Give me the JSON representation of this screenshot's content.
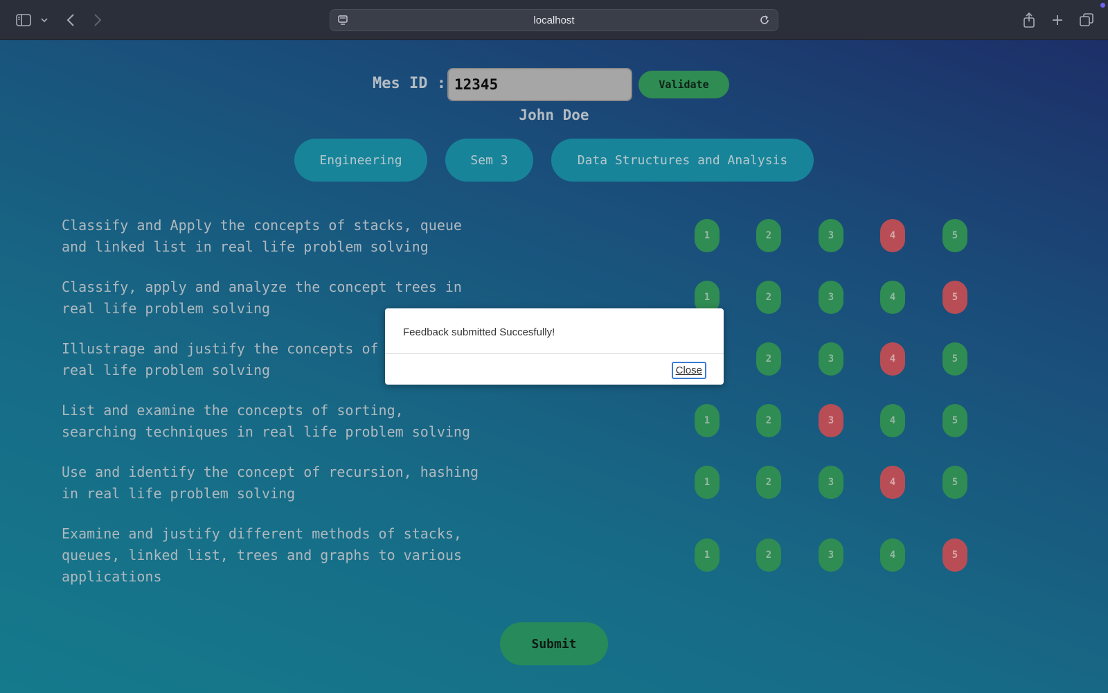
{
  "browser": {
    "url": "localhost",
    "icons": [
      "sidebar-icon",
      "chevron-down-icon",
      "back-icon",
      "forward-icon",
      "site-settings-icon",
      "reload-icon",
      "share-icon",
      "new-tab-icon",
      "tabs-overview-icon"
    ]
  },
  "form": {
    "id_label": "Mes ID :",
    "id_value": "12345",
    "validate_label": "Validate",
    "student_name": "John Doe",
    "tags": [
      "Engineering",
      "Sem 3",
      "Data Structures and Analysis"
    ],
    "questions": [
      {
        "text": "Classify and Apply the concepts of stacks, queue\nand linked list in real life problem solving",
        "selected": 4
      },
      {
        "text": "Classify, apply and analyze the concept trees in\nreal life problem solving",
        "selected": 5
      },
      {
        "text": "Illustrage and justify the concepts of graphs in\nreal life problem solving",
        "selected": 4
      },
      {
        "text": "List and examine the concepts of sorting,\nsearching techniques in real life problem solving",
        "selected": 3
      },
      {
        "text": "Use and identify the concept of recursion, hashing\nin real life problem solving",
        "selected": 4
      },
      {
        "text": "Examine and justify different methods of stacks,\nqueues, linked list, trees and graphs to various\napplications",
        "selected": 5
      }
    ],
    "rating_options": [
      "1",
      "2",
      "3",
      "4",
      "5"
    ],
    "submit_label": "Submit"
  },
  "colors": {
    "rating_unselected": "#2f8c52",
    "rating_selected": "#b94d55",
    "pill": "#17849a"
  },
  "modal": {
    "message": "Feedback submitted Succesfully!",
    "close_label": "Close"
  }
}
